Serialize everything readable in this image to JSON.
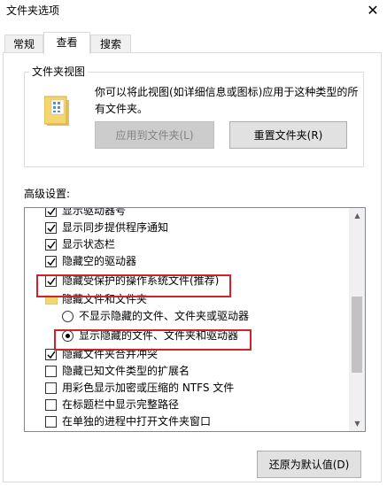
{
  "window": {
    "title": "文件夹选项",
    "close_glyph": "✕"
  },
  "tabs": [
    {
      "label": "常规",
      "active": false
    },
    {
      "label": "查看",
      "active": true
    },
    {
      "label": "搜索",
      "active": false
    }
  ],
  "folder_views": {
    "legend": "文件夹视图",
    "description": "你可以将此视图(如详细信息或图标)应用于这种类型的所有文件夹。",
    "apply_button": "应用到文件夹(L)",
    "reset_button": "重置文件夹(R)"
  },
  "advanced": {
    "label": "高级设置:",
    "items": [
      {
        "type": "checkbox",
        "label": "显示驱动器号",
        "checked": true
      },
      {
        "type": "checkbox",
        "label": "显示同步提供程序通知",
        "checked": true
      },
      {
        "type": "checkbox",
        "label": "显示状态栏",
        "checked": true
      },
      {
        "type": "checkbox",
        "label": "隐藏空的驱动器",
        "checked": true
      },
      {
        "type": "checkbox",
        "label": "隐藏受保护的操作系统文件(推荐)",
        "checked": true
      },
      {
        "type": "folder",
        "label": "隐藏文件和文件夹"
      },
      {
        "type": "radio",
        "label": "不显示隐藏的文件、文件夹或驱动器",
        "checked": false
      },
      {
        "type": "radio",
        "label": "显示隐藏的文件、文件夹和驱动器",
        "checked": true
      },
      {
        "type": "checkbox",
        "label": "隐藏文件夹合并冲突",
        "checked": true
      },
      {
        "type": "checkbox",
        "label": "隐藏已知文件类型的扩展名",
        "checked": false
      },
      {
        "type": "checkbox",
        "label": "用彩色显示加密或压缩的 NTFS 文件",
        "checked": false
      },
      {
        "type": "checkbox",
        "label": "在标题栏中显示完整路径",
        "checked": false
      },
      {
        "type": "checkbox",
        "label": "在单独的进程中打开文件夹窗口",
        "checked": false
      }
    ]
  },
  "restore_button": "还原为默认值(D)",
  "colors": {
    "highlight": "#d1222a",
    "folder_yellow": "#f5d66e"
  }
}
